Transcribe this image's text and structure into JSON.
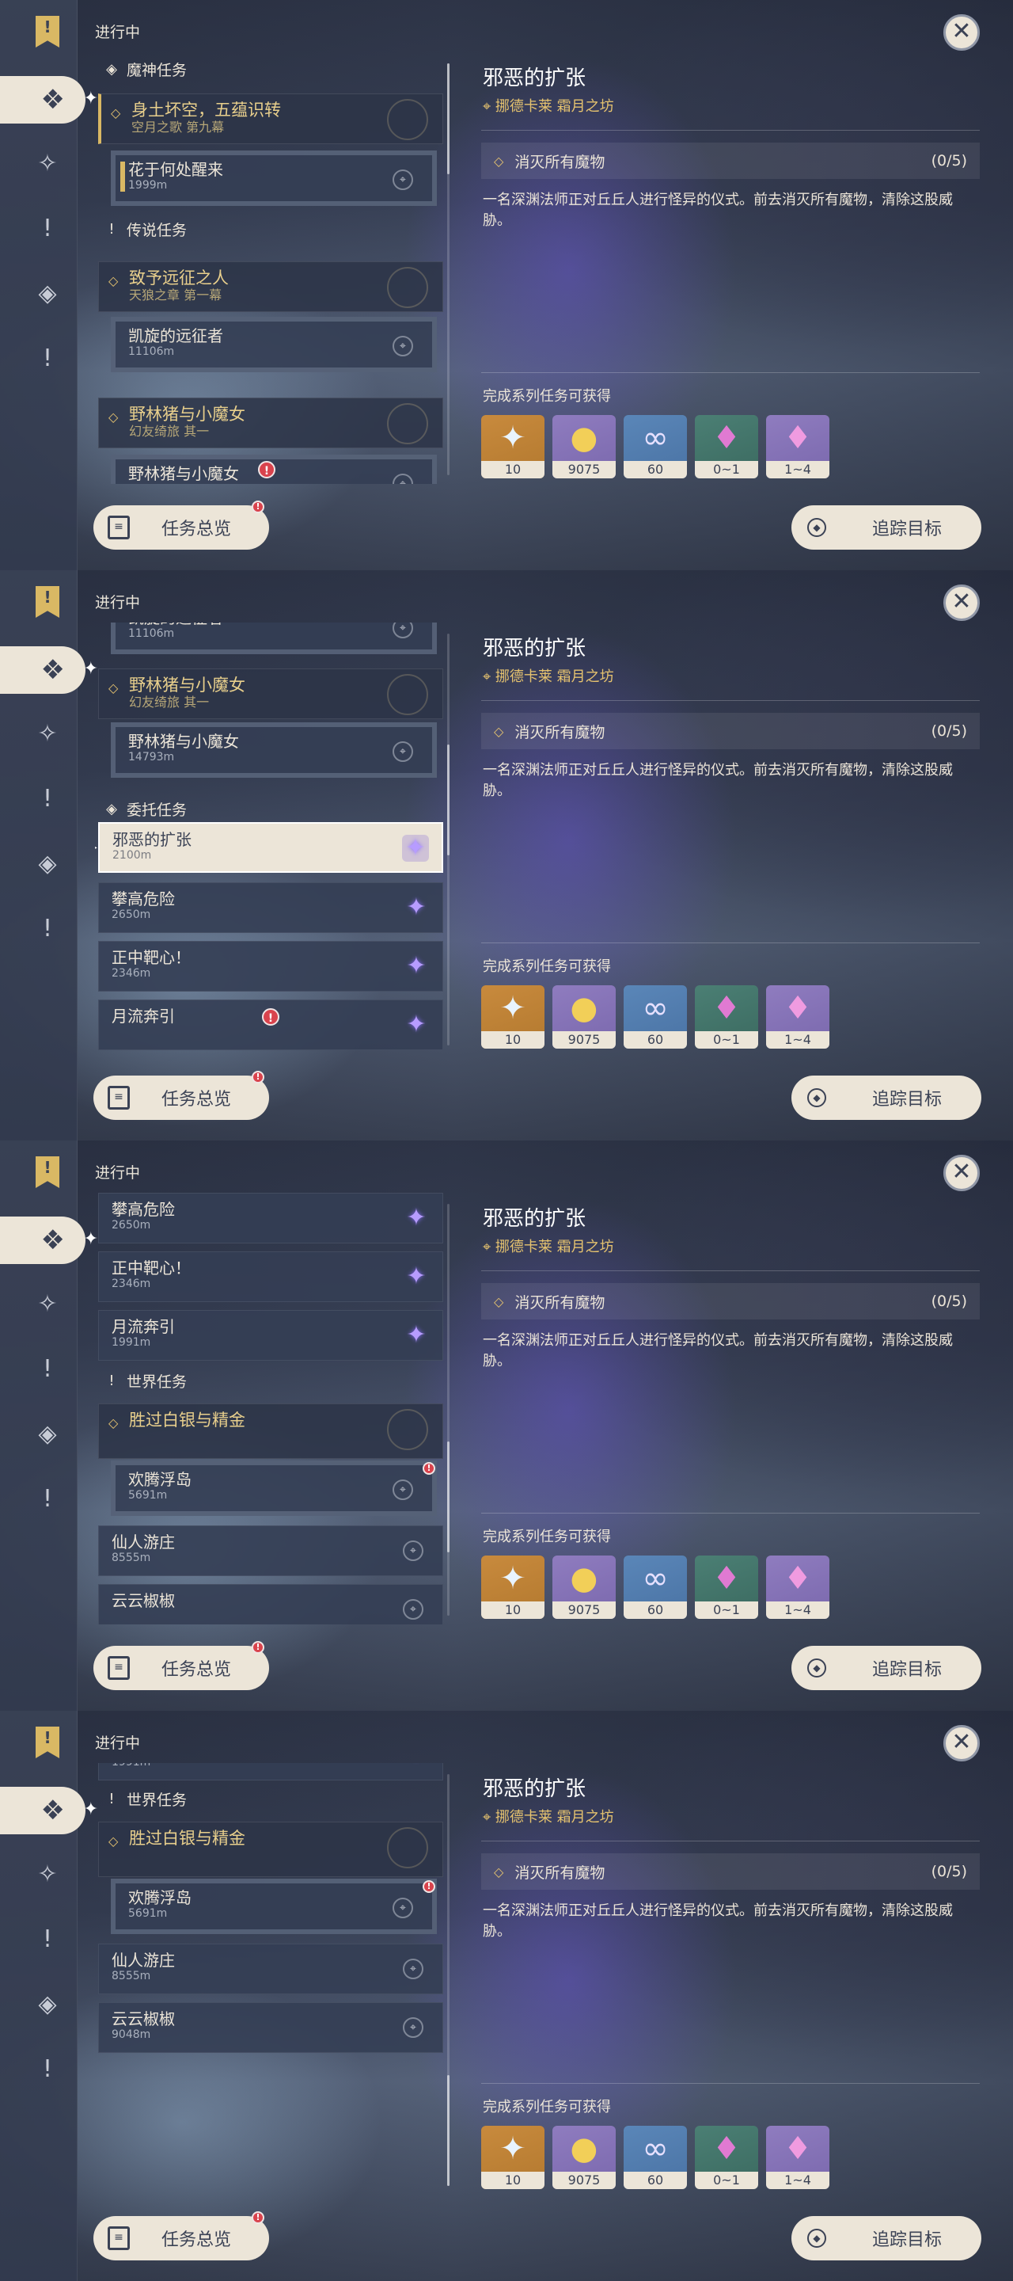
{
  "ui": {
    "status": "进行中",
    "overview": "任务总览",
    "track": "追踪目标",
    "close": "✕"
  },
  "detail": {
    "title": "邪恶的扩张",
    "location": "挪德卡莱 霜月之坊",
    "objective": "消灭所有魔物",
    "objective_count": "(0/5)",
    "description": "一名深渊法师正对丘丘人进行怪异的仪式。前去消灭所有魔物，清除这股威胁。",
    "rewards_title": "完成系列任务可获得",
    "rewards": [
      {
        "count": "10",
        "icon": "primogem-icon"
      },
      {
        "count": "9075",
        "icon": "mora-icon"
      },
      {
        "count": "60",
        "icon": "adventure-exp-icon"
      },
      {
        "count": "0~1",
        "icon": "green-crystal-icon"
      },
      {
        "count": "1~4",
        "icon": "purple-crystal-icon"
      }
    ]
  },
  "cats": {
    "archon": "魔神任务",
    "legend": "传说任务",
    "commission": "委托任务",
    "world": "世界任务"
  },
  "quests": {
    "q1": {
      "title": "身土坏空，五蕴识转",
      "sub": "空月之歌 第九幕"
    },
    "q1a": {
      "title": "花于何处醒来",
      "dist": "1999m"
    },
    "q2": {
      "title": "致予远征之人",
      "sub": "天狼之章 第一幕"
    },
    "q2a": {
      "title": "凯旋的远征者",
      "dist": "11106m"
    },
    "q3": {
      "title": "野林猪与小魔女",
      "sub": "幻友绮旅 其一"
    },
    "q3a": {
      "title": "野林猪与小魔女",
      "dist": "14793m"
    },
    "c1": {
      "title": "邪恶的扩张",
      "dist": "2100m"
    },
    "c2": {
      "title": "攀高危险",
      "dist": "2650m"
    },
    "c3": {
      "title": "正中靶心！",
      "dist": "2346m"
    },
    "c4": {
      "title": "月流奔引",
      "dist": "1991m"
    },
    "w1": {
      "title": "胜过白银与精金"
    },
    "w1a": {
      "title": "欢腾浮岛",
      "dist": "5691m"
    },
    "w2": {
      "title": "仙人游庄",
      "dist": "8555m"
    },
    "w3": {
      "title": "云云椒椒",
      "dist": "9048m"
    }
  },
  "colors": {
    "accent": "#d9b864",
    "panel_light": "#ece5d8",
    "alert": "#d9434d",
    "commission": "#b79cff"
  }
}
